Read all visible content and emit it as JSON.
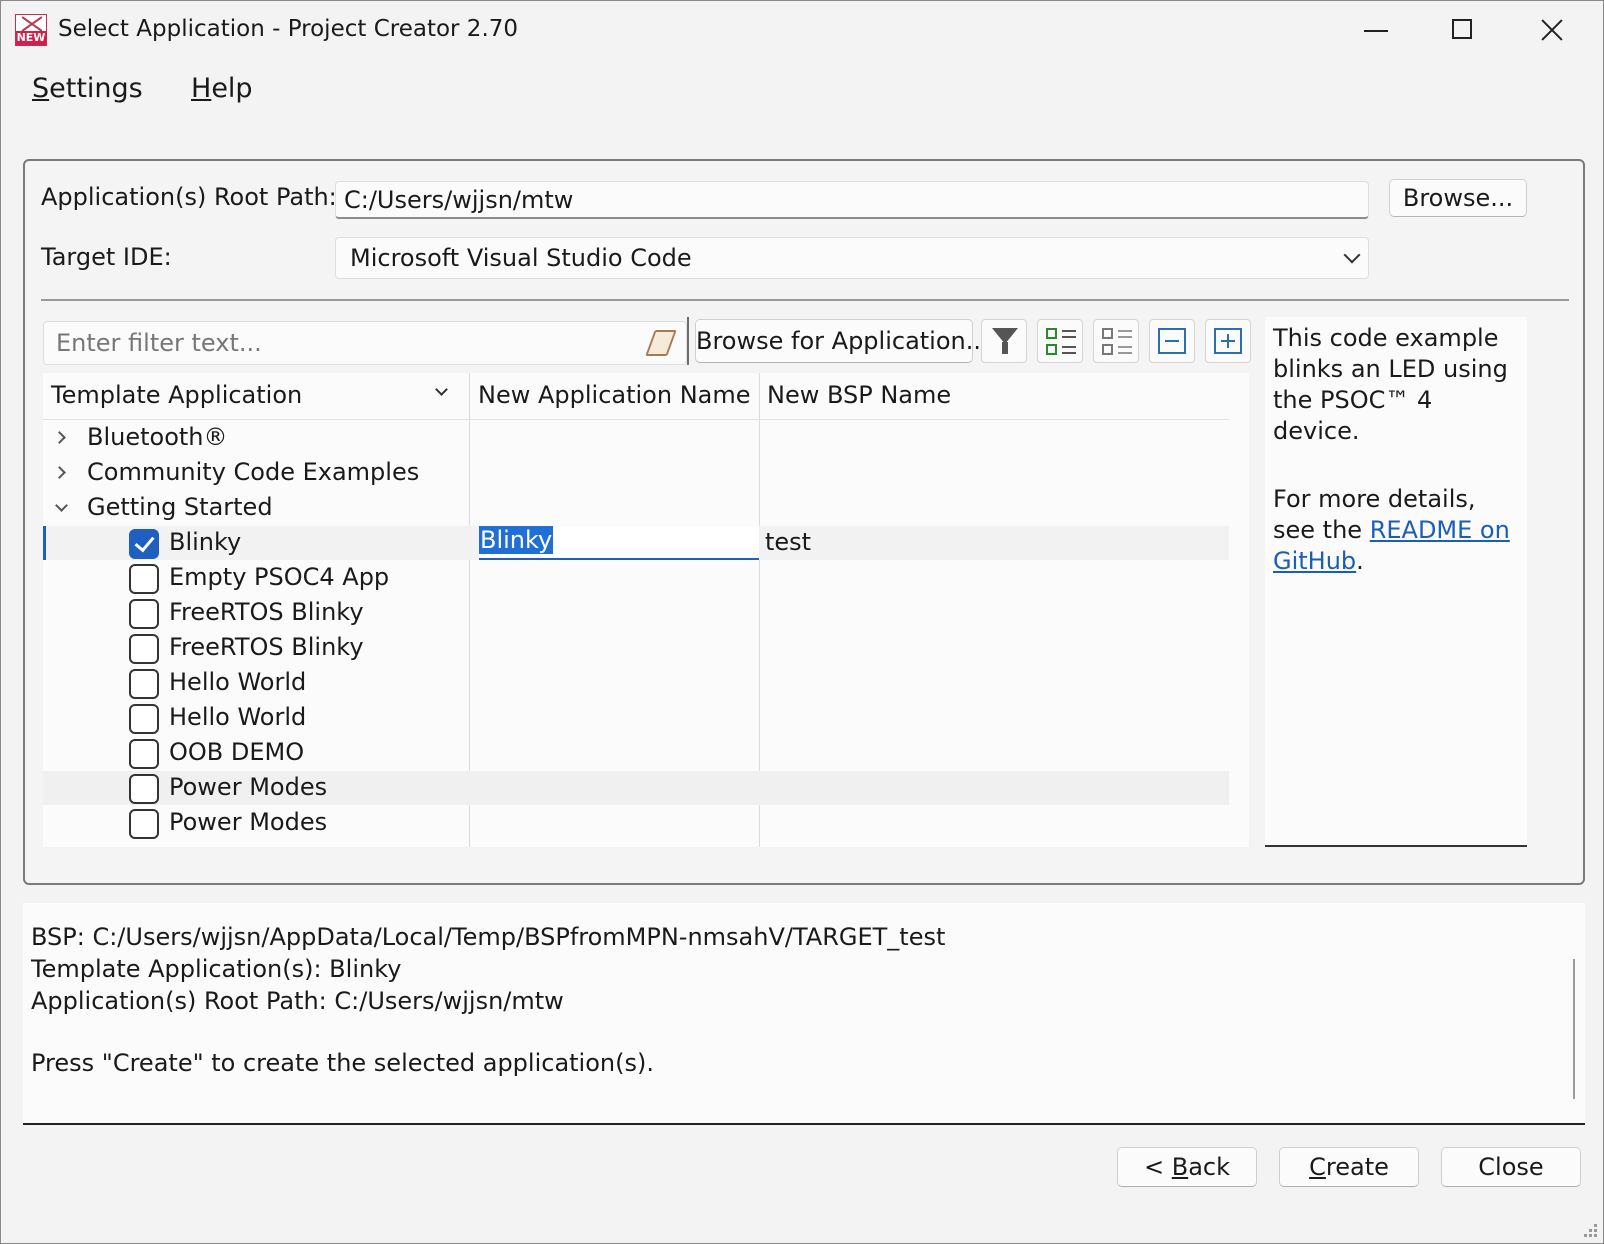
{
  "window": {
    "title": "Select Application - Project Creator 2.70",
    "icon_badge": "NEW"
  },
  "menu": {
    "settings_first": "S",
    "settings_rest": "ettings",
    "help_first": "H",
    "help_rest": "elp"
  },
  "form": {
    "root_path_label": "Application(s) Root Path:",
    "root_path_value": "C:/Users/wjjsn/mtw",
    "browse_label": "Browse...",
    "target_ide_label": "Target IDE:",
    "target_ide_value": "Microsoft Visual Studio Code"
  },
  "toolbar": {
    "filter_placeholder": "Enter filter text...",
    "browse_app_label": "Browse for Application..."
  },
  "table": {
    "headers": [
      "Template Application",
      "New Application Name",
      "New BSP Name"
    ],
    "categories": [
      "Bluetooth®",
      "Community Code Examples",
      "Getting Started"
    ],
    "items": [
      {
        "label": "Blinky",
        "checked": true,
        "app_name": "Blinky",
        "bsp_name": "test"
      },
      {
        "label": "Empty PSOC4 App",
        "checked": false
      },
      {
        "label": "FreeRTOS Blinky",
        "checked": false
      },
      {
        "label": "FreeRTOS Blinky",
        "checked": false
      },
      {
        "label": "Hello World",
        "checked": false
      },
      {
        "label": "Hello World",
        "checked": false
      },
      {
        "label": "OOB DEMO",
        "checked": false
      },
      {
        "label": "Power Modes",
        "checked": false
      },
      {
        "label": "Power Modes",
        "checked": false
      }
    ]
  },
  "description": {
    "text1": "This code example blinks an LED using the PSOC™ 4 device.",
    "text2_before": "For more details, see the ",
    "link": "README on GitHub",
    "text2_after": "."
  },
  "output": {
    "line1": "BSP: C:/Users/wjjsn/AppData/Local/Temp/BSPfromMPN-nmsahV/TARGET_test",
    "line2": "Template Application(s): Blinky",
    "line3": "Application(s) Root Path: C:/Users/wjjsn/mtw",
    "line4": "Press \"Create\" to create the selected application(s)."
  },
  "buttons": {
    "back_prefix": "< ",
    "back_first": "B",
    "back_rest": "ack",
    "create_first": "C",
    "create_rest": "reate",
    "close_label": "Close"
  },
  "colors": {
    "accent": "#1f5fbf",
    "link": "#1a5fb4",
    "icon_red": "#d21f4a"
  }
}
